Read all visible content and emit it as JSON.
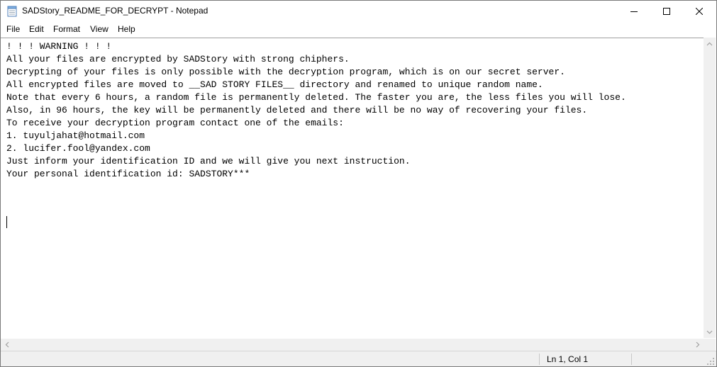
{
  "window": {
    "title": "SADStory_README_FOR_DECRYPT - Notepad",
    "controls": [
      "minimize",
      "maximize",
      "close"
    ]
  },
  "menu": {
    "items": [
      "File",
      "Edit",
      "Format",
      "View",
      "Help"
    ]
  },
  "editor": {
    "lines": [
      "! ! ! WARNING ! ! !",
      "All your files are encrypted by SADStory with strong chiphers.",
      "Decrypting of your files is only possible with the decryption program, which is on our secret server.",
      "All encrypted files are moved to __SAD STORY FILES__ directory and renamed to unique random name.",
      "Note that every 6 hours, a random file is permanently deleted. The faster you are, the less files you will lose.",
      "Also, in 96 hours, the key will be permanently deleted and there will be no way of recovering your files.",
      "To receive your decryption program contact one of the emails:",
      "1. tuyuljahat@hotmail.com",
      "2. lucifer.fool@yandex.com",
      "Just inform your identification ID and we will give you next instruction.",
      "Your personal identification id: SADSTORY***"
    ]
  },
  "status": {
    "position": "Ln 1, Col 1"
  },
  "icons": {
    "app": "notepad-icon",
    "minimize": "minimize-icon",
    "maximize": "maximize-icon",
    "close": "close-icon",
    "scroll_up": "chevron-up-icon",
    "scroll_down": "chevron-down-icon",
    "scroll_left": "chevron-left-icon",
    "scroll_right": "chevron-right-icon",
    "grip": "resize-grip-icon"
  }
}
